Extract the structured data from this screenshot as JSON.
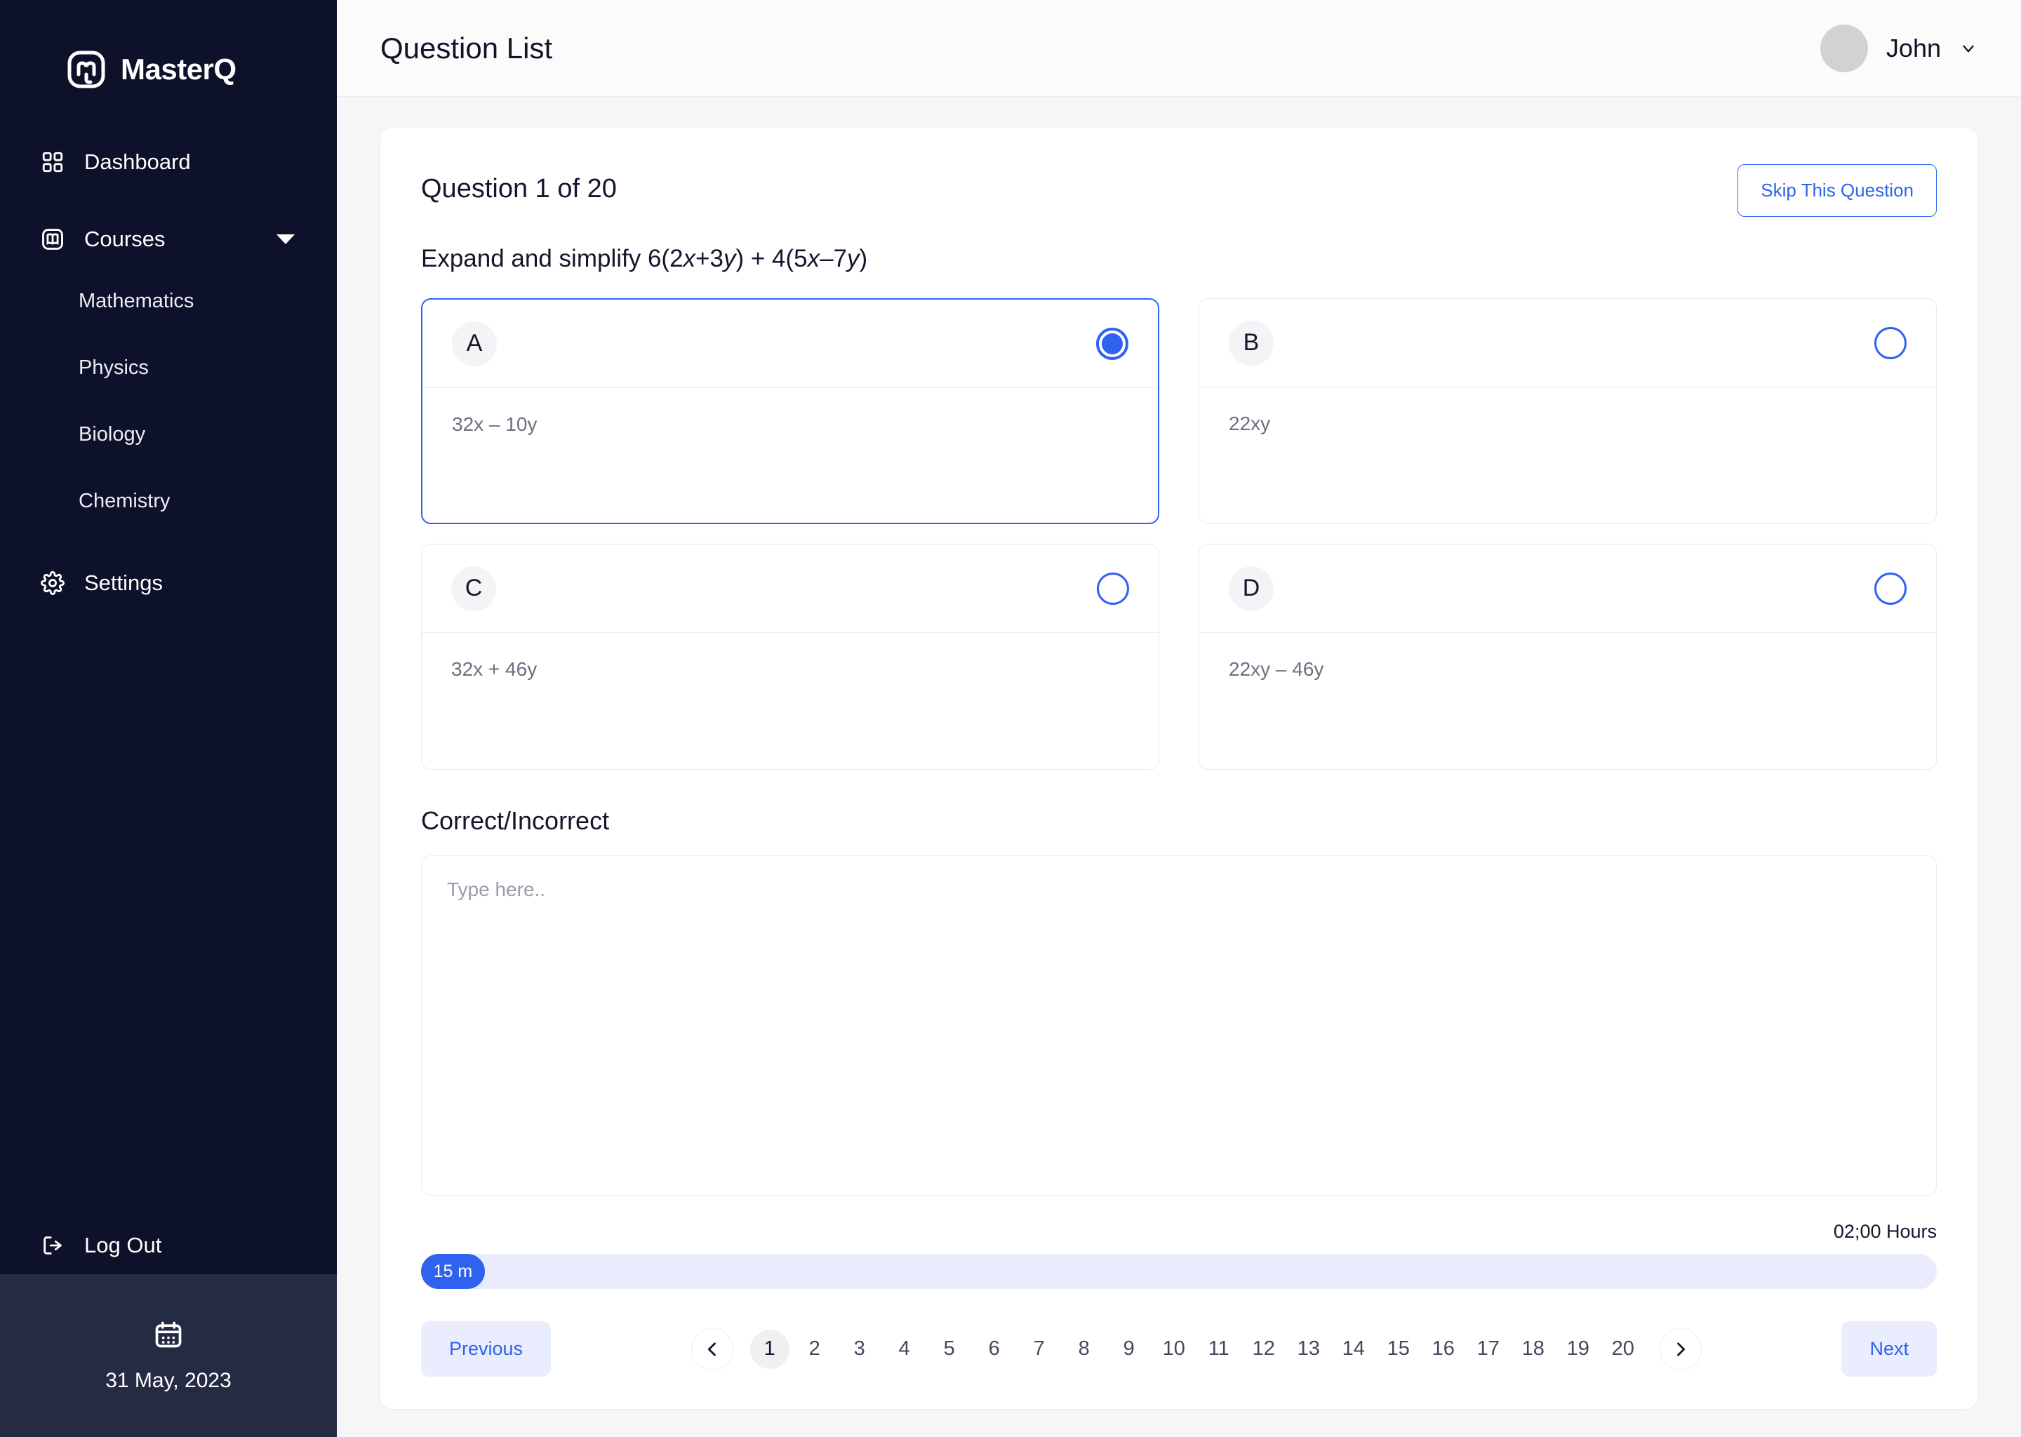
{
  "brand": {
    "name": "MasterQ",
    "logo_icon": "mastodon-logo-icon"
  },
  "sidebar": {
    "items": [
      {
        "label": "Dashboard",
        "icon": "grid-icon"
      },
      {
        "label": "Courses",
        "icon": "book-icon",
        "expand_icon": "caret-down-icon"
      }
    ],
    "courses": [
      {
        "label": "Mathematics"
      },
      {
        "label": "Physics"
      },
      {
        "label": "Biology"
      },
      {
        "label": "Chemistry"
      }
    ],
    "settings": {
      "label": "Settings",
      "icon": "gear-icon"
    },
    "logout": {
      "label": "Log Out",
      "icon": "logout-icon"
    },
    "date": {
      "value": "31 May, 2023",
      "icon": "calendar-icon"
    }
  },
  "topbar": {
    "title": "Question List",
    "user_name": "John",
    "avatar_icon": "avatar-icon",
    "chevron_icon": "chevron-down-icon"
  },
  "question": {
    "counter": "Question 1 of 20",
    "skip_label": "Skip This Question",
    "prompt_prefix": "Expand and simplify 6(2",
    "prompt_v1": "x",
    "prompt_mid1": "+3",
    "prompt_v2": "y",
    "prompt_mid2": ") + 4(5",
    "prompt_v3": "x",
    "prompt_mid3": "–7",
    "prompt_v4": "y",
    "prompt_suffix": ")",
    "options": [
      {
        "letter": "A",
        "text": "32x – 10y",
        "selected": true
      },
      {
        "letter": "B",
        "text": "22xy",
        "selected": false
      },
      {
        "letter": "C",
        "text": "32x + 46y",
        "selected": false
      },
      {
        "letter": "D",
        "text": "22xy – 46y",
        "selected": false
      }
    ],
    "answer_label": "Correct/Incorrect",
    "answer_placeholder": "Type here..",
    "answer_value": ""
  },
  "timer": {
    "total_label": "02;00 Hours",
    "elapsed_label": "15 m",
    "progress_percent": 4.2
  },
  "pagination": {
    "previous_label": "Previous",
    "next_label": "Next",
    "prev_arrow_icon": "chevron-left-icon",
    "next_arrow_icon": "chevron-right-icon",
    "current_page": "1",
    "pages": [
      "1",
      "2",
      "3",
      "4",
      "5",
      "6",
      "7",
      "8",
      "9",
      "10",
      "11",
      "12",
      "13",
      "14",
      "15",
      "16",
      "17",
      "18",
      "19",
      "20"
    ]
  },
  "colors": {
    "accent": "#2f63ef",
    "sidebar_bg": "#0d1129",
    "date_bg": "#262b44",
    "page_bg": "#f6f6f8"
  }
}
